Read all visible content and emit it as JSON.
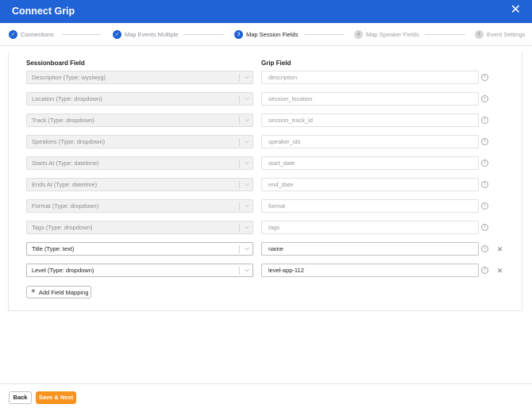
{
  "header": {
    "title": "Connect Grip",
    "close_glyph": "✕"
  },
  "steps": [
    {
      "label": "Connections",
      "state": "done",
      "marker": "✓"
    },
    {
      "label": "Map Events Multiple",
      "state": "done",
      "marker": "✓"
    },
    {
      "label": "Map Session Fields",
      "state": "active",
      "marker": "3"
    },
    {
      "label": "Map Speaker Fields",
      "state": "todo",
      "marker": "4"
    },
    {
      "label": "Event Settings",
      "state": "todo",
      "marker": "5"
    }
  ],
  "columns": {
    "left": "Sessionboard Field",
    "right": "Grip Field"
  },
  "mappings": [
    {
      "sessionboard": "Description (Type: wysiwyg)",
      "grip": "description",
      "enabled": false
    },
    {
      "sessionboard": "Location (Type: dropdown)",
      "grip": "session_location",
      "enabled": false
    },
    {
      "sessionboard": "Track (Type: dropdown)",
      "grip": "session_track_id",
      "enabled": false
    },
    {
      "sessionboard": "Speakers (Type: dropdown)",
      "grip": "speaker_ids",
      "enabled": false
    },
    {
      "sessionboard": "Starts At (Type: datetime)",
      "grip": "start_date",
      "enabled": false
    },
    {
      "sessionboard": "Ends At (Type: datetime)",
      "grip": "end_date",
      "enabled": false
    },
    {
      "sessionboard": "Format (Type: dropdown)",
      "grip": "format",
      "enabled": false
    },
    {
      "sessionboard": "Tags (Type: dropdown)",
      "grip": "tags",
      "enabled": false
    },
    {
      "sessionboard": "Title (Type: text)",
      "grip": "name",
      "enabled": true
    },
    {
      "sessionboard": "Level (Type: dropdown)",
      "grip": "level-app-112",
      "enabled": true
    }
  ],
  "add_button": {
    "label": "Add Field Mapping",
    "icon": "plus-icon"
  },
  "footer": {
    "back_label": "Back",
    "save_label": "Save & Next"
  },
  "colors": {
    "brand_blue": "#1f63d6",
    "accent_orange": "#f7931e"
  }
}
